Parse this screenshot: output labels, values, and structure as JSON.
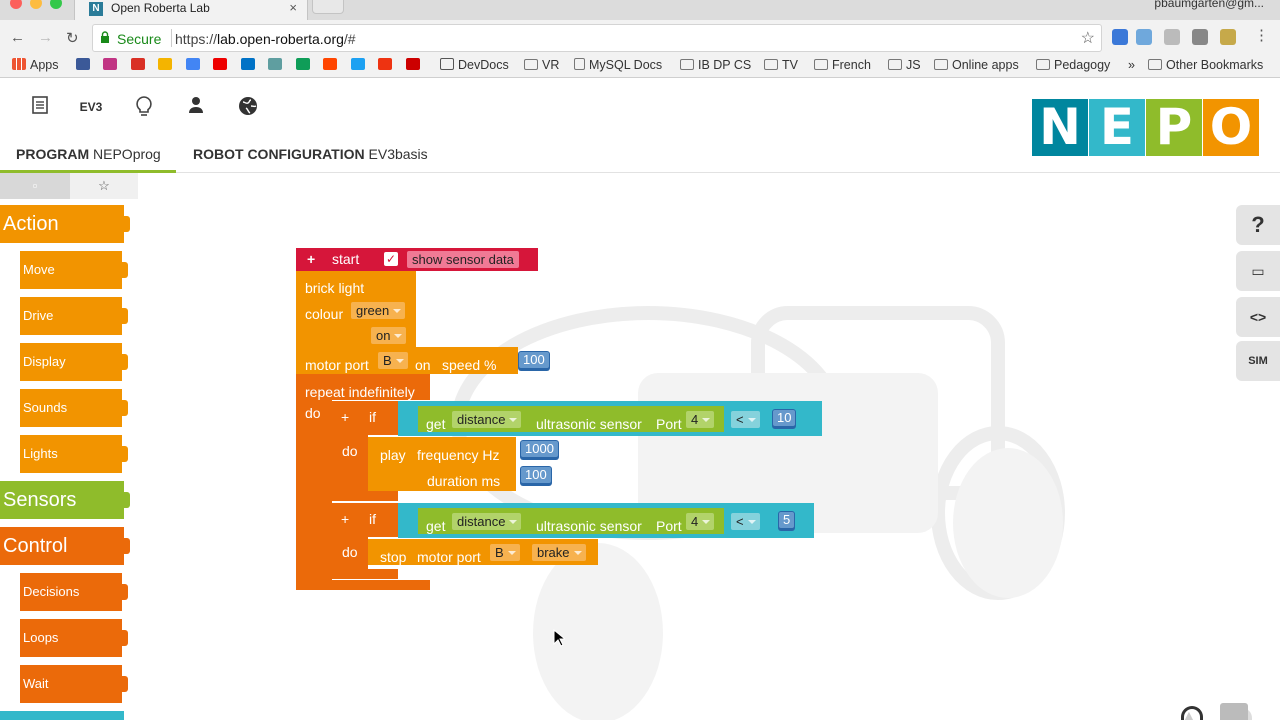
{
  "browser": {
    "tab_title": "Open Roberta Lab",
    "tab_close": "×",
    "user": "pbaumgarten@gm...",
    "secure_label": "Secure",
    "url_scheme": "https://",
    "url_host": "lab.open-roberta.org",
    "url_path": "/#",
    "bookmarks": [
      {
        "label": "Apps"
      },
      {
        "label": "DevDocs"
      },
      {
        "label": "VR"
      },
      {
        "label": "MySQL Docs"
      },
      {
        "label": "IB DP CS"
      },
      {
        "label": "TV"
      },
      {
        "label": "French"
      },
      {
        "label": "JS"
      },
      {
        "label": "Online apps"
      },
      {
        "label": "Pedagogy"
      },
      {
        "label": "»"
      },
      {
        "label": "Other Bookmarks"
      }
    ]
  },
  "header": {
    "ev3_label": "EV3",
    "program_label": "PROGRAM",
    "program_name": "NEPOprog",
    "robot_config_label": "ROBOT CONFIGURATION",
    "robot_config_name": "EV3basis",
    "logo": [
      "N",
      "E",
      "P",
      "O"
    ]
  },
  "toolbox": {
    "categories": {
      "action": "Action",
      "move": "Move",
      "drive": "Drive",
      "display": "Display",
      "sounds": "Sounds",
      "lights": "Lights",
      "sensors": "Sensors",
      "control": "Control",
      "decisions": "Decisions",
      "loops": "Loops",
      "wait": "Wait"
    },
    "colors": {
      "action": "#f29400",
      "sensors": "#8fbc2b",
      "control": "#eb6a0a",
      "math": "#33b8ca"
    }
  },
  "program": {
    "start_label": "start",
    "show_sensor_data": "show sensor data",
    "brick_light": "brick light",
    "colour_label": "colour",
    "colour_value": "green",
    "on_value": "on",
    "motor_port_label": "motor port",
    "motor_port_value": "B",
    "on_label": "on",
    "speed_label": "speed %",
    "speed_value": "100",
    "repeat_label": "repeat indefinitely",
    "do_label": "do",
    "if_label": "if",
    "get_label": "get",
    "distance_label": "distance",
    "ultrasonic_label": "ultrasonic sensor",
    "port_label": "Port",
    "port_value": "4",
    "op_label": "<",
    "if1_value": "10",
    "play_label": "play",
    "frequency_label": "frequency Hz",
    "frequency_value": "1000",
    "duration_label": "duration ms",
    "duration_value": "100",
    "if2_value": "5",
    "stop_label": "stop",
    "brake_value": "brake"
  },
  "side": {
    "sim_label": "SIM",
    "code_label": "<>",
    "help_label": "?"
  }
}
